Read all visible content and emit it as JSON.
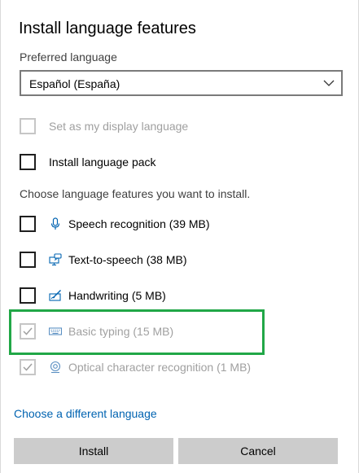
{
  "dialog": {
    "title": "Install language features",
    "preferred_label": "Preferred language",
    "preferred_value": "Español (España)",
    "display_language_label": "Set as my display language",
    "language_pack_label": "Install language pack",
    "features_prompt": "Choose language features you want to install.",
    "features": [
      {
        "label": "Speech recognition (39 MB)",
        "icon": "microphone-icon",
        "checked": false,
        "disabled": false
      },
      {
        "label": "Text-to-speech (38 MB)",
        "icon": "speech-bubble-monitor-icon",
        "checked": false,
        "disabled": false
      },
      {
        "label": "Handwriting (5 MB)",
        "icon": "pen-tablet-icon",
        "checked": false,
        "disabled": false
      },
      {
        "label": "Basic typing (15 MB)",
        "icon": "keyboard-icon",
        "checked": true,
        "disabled": true
      },
      {
        "label": "Optical character recognition (1 MB)",
        "icon": "eye-scan-icon",
        "checked": true,
        "disabled": true
      }
    ],
    "different_language_link": "Choose a different language",
    "install_button": "Install",
    "cancel_button": "Cancel"
  },
  "colors": {
    "link": "#0063b1",
    "highlight_border": "#21a747",
    "button_bg": "#cccccc",
    "disabled_text": "#a0a0a0"
  }
}
